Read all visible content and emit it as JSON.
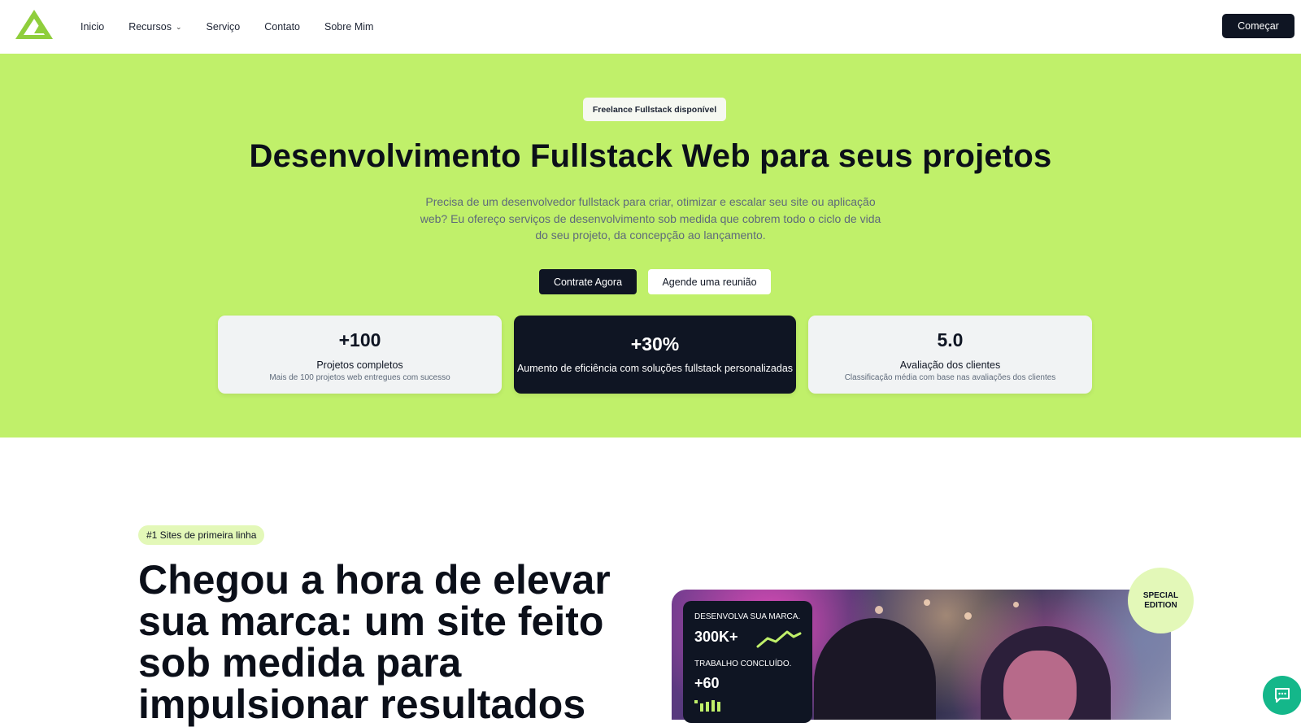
{
  "nav": {
    "links": [
      "Inicio",
      "Recursos",
      "Serviço",
      "Contato",
      "Sobre Mim"
    ],
    "cta": "Começar"
  },
  "hero": {
    "badge": "Freelance Fullstack disponível",
    "title": "Desenvolvimento Fullstack Web para seus projetos",
    "subtitle": "Precisa de um desenvolvedor fullstack para criar, otimizar e escalar seu site ou aplicação web? Eu ofereço serviços de desenvolvimento sob medida que cobrem todo o ciclo de vida do seu projeto, da concepção ao lançamento.",
    "primary_button": "Contrate Agora",
    "secondary_button": "Agende uma reunião"
  },
  "stats": [
    {
      "value": "+100",
      "label": "Projetos completos",
      "desc": "Mais de 100 projetos web entregues com sucesso"
    },
    {
      "value": "+30%",
      "label": "Aumento de eficiência com soluções fullstack personalizadas"
    },
    {
      "value": "5.0",
      "label": "Avaliação dos clientes",
      "desc": "Classificação média com base nas avaliações dos clientes"
    }
  ],
  "section2": {
    "tag": "#1 Sites de primeira linha",
    "title": "Chegou a hora de elevar sua marca: um site feito sob medida para impulsionar resultados",
    "overlay": {
      "label1": "DESENVOLVA SUA MARCA.",
      "value1": "300K+",
      "label2": "TRABALHO CONCLUÍDO.",
      "value2": "+60"
    },
    "special_line1": "SPECIAL",
    "special_line2": "EDITION"
  },
  "colors": {
    "accent": "#c0f06a",
    "dark": "#0f1523",
    "chat": "#14b78a"
  }
}
